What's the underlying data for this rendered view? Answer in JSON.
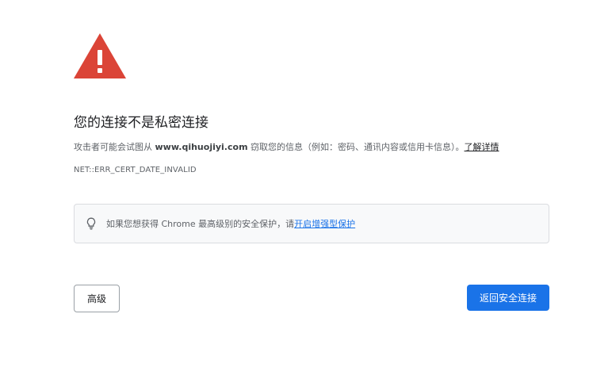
{
  "interstitial": {
    "heading": "您的连接不是私密连接",
    "explanation_prefix": "攻击者可能会试图从 ",
    "domain": "www.qihuojiyi.com",
    "explanation_suffix": " 窃取您的信息（例如：密码、通讯内容或信用卡信息）。",
    "learn_more_label": "了解详情",
    "error_code": "NET::ERR_CERT_DATE_INVALID",
    "tip_text": "如果您想获得 Chrome 最高级别的安全保护，请",
    "tip_link_label": "开启增强型保护",
    "advanced_button_label": "高级",
    "back_button_label": "返回安全连接"
  },
  "icons": {
    "warning": "warning-triangle-icon",
    "tip": "lightbulb-icon"
  },
  "colors": {
    "warning_red": "#db4437",
    "primary_blue": "#1a73e8",
    "tip_background": "#f8f9fa"
  }
}
